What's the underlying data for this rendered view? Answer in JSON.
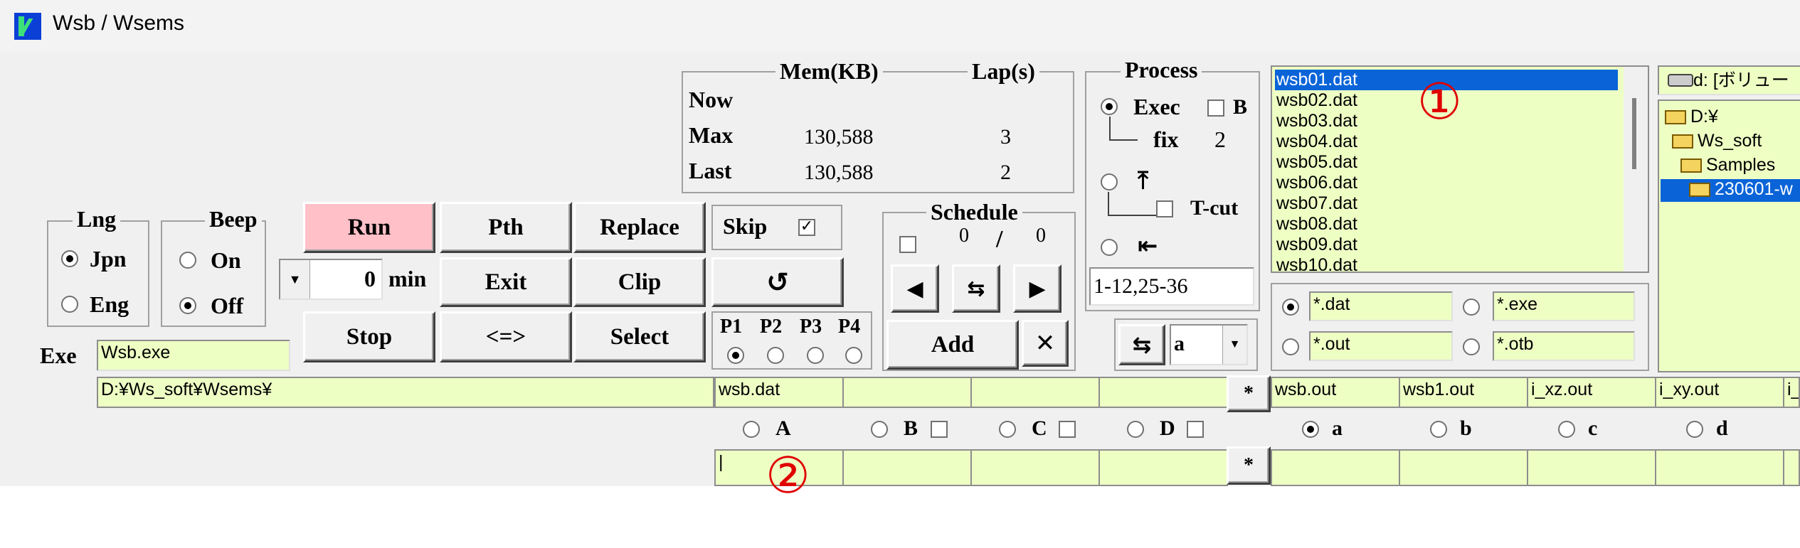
{
  "window": {
    "title": "Wsb / Wsems"
  },
  "mem_group": {
    "mem_header": "Mem(KB)",
    "lap_header": "Lap(s)",
    "rows": [
      {
        "label": "Now",
        "mem": "",
        "lap": ""
      },
      {
        "label": "Max",
        "mem": "130,588",
        "lap": "3"
      },
      {
        "label": "Last",
        "mem": "130,588",
        "lap": "2"
      }
    ]
  },
  "process": {
    "title": "Process",
    "exec_label": "Exec",
    "b_label": "B",
    "fix_label": "fix",
    "fix_value": "2",
    "tcut_label": "T-cut",
    "range_value": "1-12,25-36",
    "mode_value": "a"
  },
  "file_list": {
    "items": [
      "wsb01.dat",
      "wsb02.dat",
      "wsb03.dat",
      "wsb04.dat",
      "wsb05.dat",
      "wsb06.dat",
      "wsb07.dat",
      "wsb08.dat",
      "wsb09.dat",
      "wsb10.dat"
    ],
    "selected": "wsb01.dat"
  },
  "drive": {
    "label": "d: [ボリュー"
  },
  "tree": {
    "items": [
      "D:¥",
      "Ws_soft",
      "Samples",
      "230601-w"
    ]
  },
  "filters": {
    "dat": "*.dat",
    "exe": "*.exe",
    "out": "*.out",
    "otb": "*.otb"
  },
  "lng": {
    "title": "Lng",
    "jpn": "Jpn",
    "eng": "Eng"
  },
  "beep": {
    "title": "Beep",
    "on": "On",
    "off": "Off"
  },
  "buttons": {
    "run": "Run",
    "pth": "Pth",
    "replace": "Replace",
    "skip": "Skip",
    "exit": "Exit",
    "clip": "Clip",
    "refresh": "↺",
    "stop": "Stop",
    "swap": "<=>",
    "select": "Select",
    "add": "Add",
    "delete": "✕"
  },
  "timer": {
    "value": "0",
    "unit": "min"
  },
  "ports": [
    "P1",
    "P2",
    "P3",
    "P4"
  ],
  "schedule": {
    "title": "Schedule",
    "count": "0",
    "slash": "/",
    "total": "0"
  },
  "exe": {
    "label": "Exe",
    "value": "Wsb.exe"
  },
  "path": {
    "value": "D:¥Ws_soft¥Wsems¥"
  },
  "input_cols": [
    "wsb.dat",
    "",
    "",
    ""
  ],
  "output_cols": [
    "wsb.out",
    "wsb1.out",
    "i_xz.out",
    "i_xy.out",
    "i_"
  ],
  "star": "*",
  "input_radios": [
    "A",
    "B",
    "C",
    "D"
  ],
  "output_radios": [
    "a",
    "b",
    "c",
    "d"
  ],
  "edit_row": {
    "first": "|"
  },
  "annotations": {
    "one": "①",
    "two": "②"
  }
}
